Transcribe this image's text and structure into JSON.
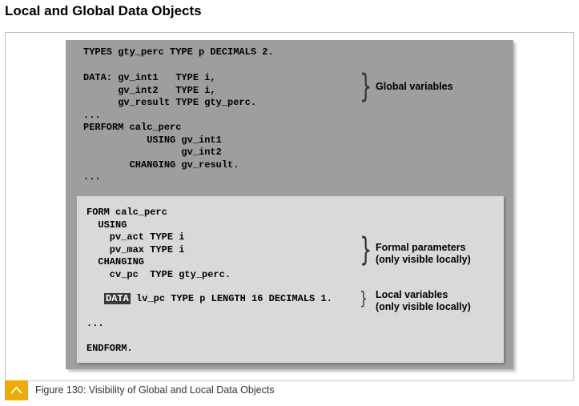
{
  "page": {
    "title": "Local and Global Data Objects"
  },
  "code_global": {
    "line1": "TYPES gty_perc TYPE p DECIMALS 2.",
    "line2": "DATA: gv_int1   TYPE i,",
    "line3": "      gv_int2   TYPE i,",
    "line4": "      gv_result TYPE gty_perc.",
    "line5": "...",
    "line6": "PERFORM calc_perc",
    "line7": "           USING gv_int1",
    "line8": "                 gv_int2",
    "line9": "        CHANGING gv_result.",
    "line10": "..."
  },
  "code_local": {
    "line1": "FORM calc_perc",
    "line2": "  USING",
    "line3": "    pv_act TYPE i",
    "line4": "    pv_max TYPE i",
    "line5": "  CHANGING",
    "line6": "    cv_pc  TYPE gty_perc.",
    "line7_keyword": "DATA",
    "line7_rest": " lv_pc TYPE p LENGTH 16 DECIMALS 1.",
    "line8": "...",
    "line9": "ENDFORM."
  },
  "annotations": {
    "global": "Global variables",
    "formal_line1": "Formal parameters",
    "formal_line2": "(only visible locally)",
    "local_line1": "Local variables",
    "local_line2": "(only visible locally)"
  },
  "caption": {
    "text": "Figure 130: Visibility of Global and Local Data Objects",
    "icon": "chevron-up-icon",
    "icon_color": "#f0ab00"
  }
}
